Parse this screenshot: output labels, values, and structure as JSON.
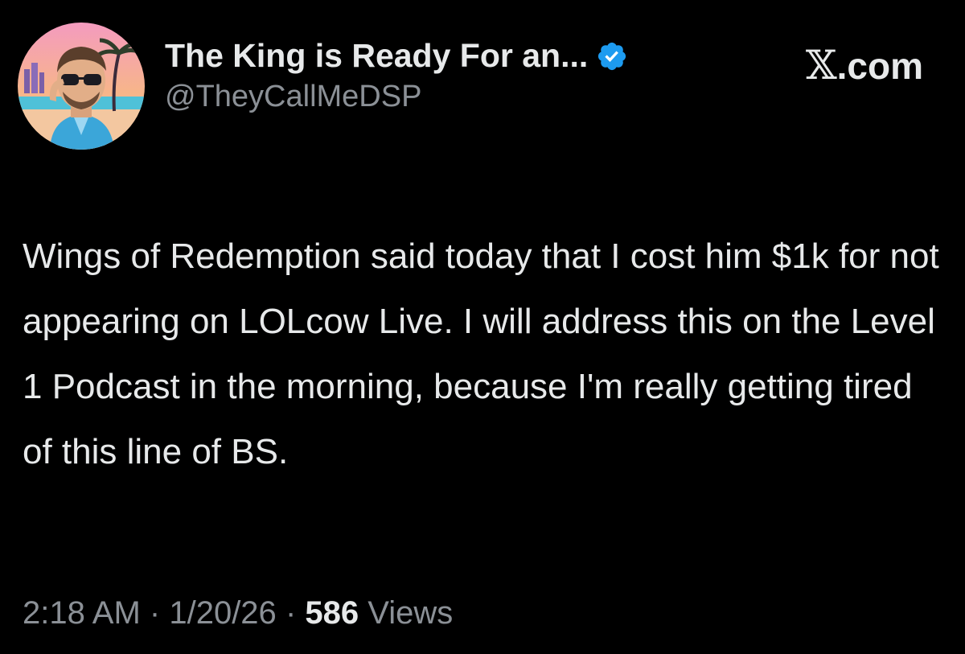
{
  "author": {
    "display_name": "The King is Ready For an...",
    "handle": "@TheyCallMeDSP",
    "verified": true
  },
  "site": {
    "x_glyph": "𝕏",
    "suffix": ".com"
  },
  "post": {
    "text": "Wings of Redemption said today that I cost him $1k for not appearing on LOLcow Live. I will address this on the Level 1 Podcast in the morning, because I'm really getting tired of this line of BS."
  },
  "meta": {
    "time": "2:18 AM",
    "separator": "·",
    "date": "1/20/26",
    "views_count": "586",
    "views_label": "Views"
  },
  "colors": {
    "background": "#000000",
    "text_primary": "#e7e9ea",
    "text_secondary": "#8b9096",
    "verified_badge": "#1d9bf0"
  },
  "icons": {
    "verified": "verified-badge-icon",
    "avatar": "avatar-image"
  }
}
